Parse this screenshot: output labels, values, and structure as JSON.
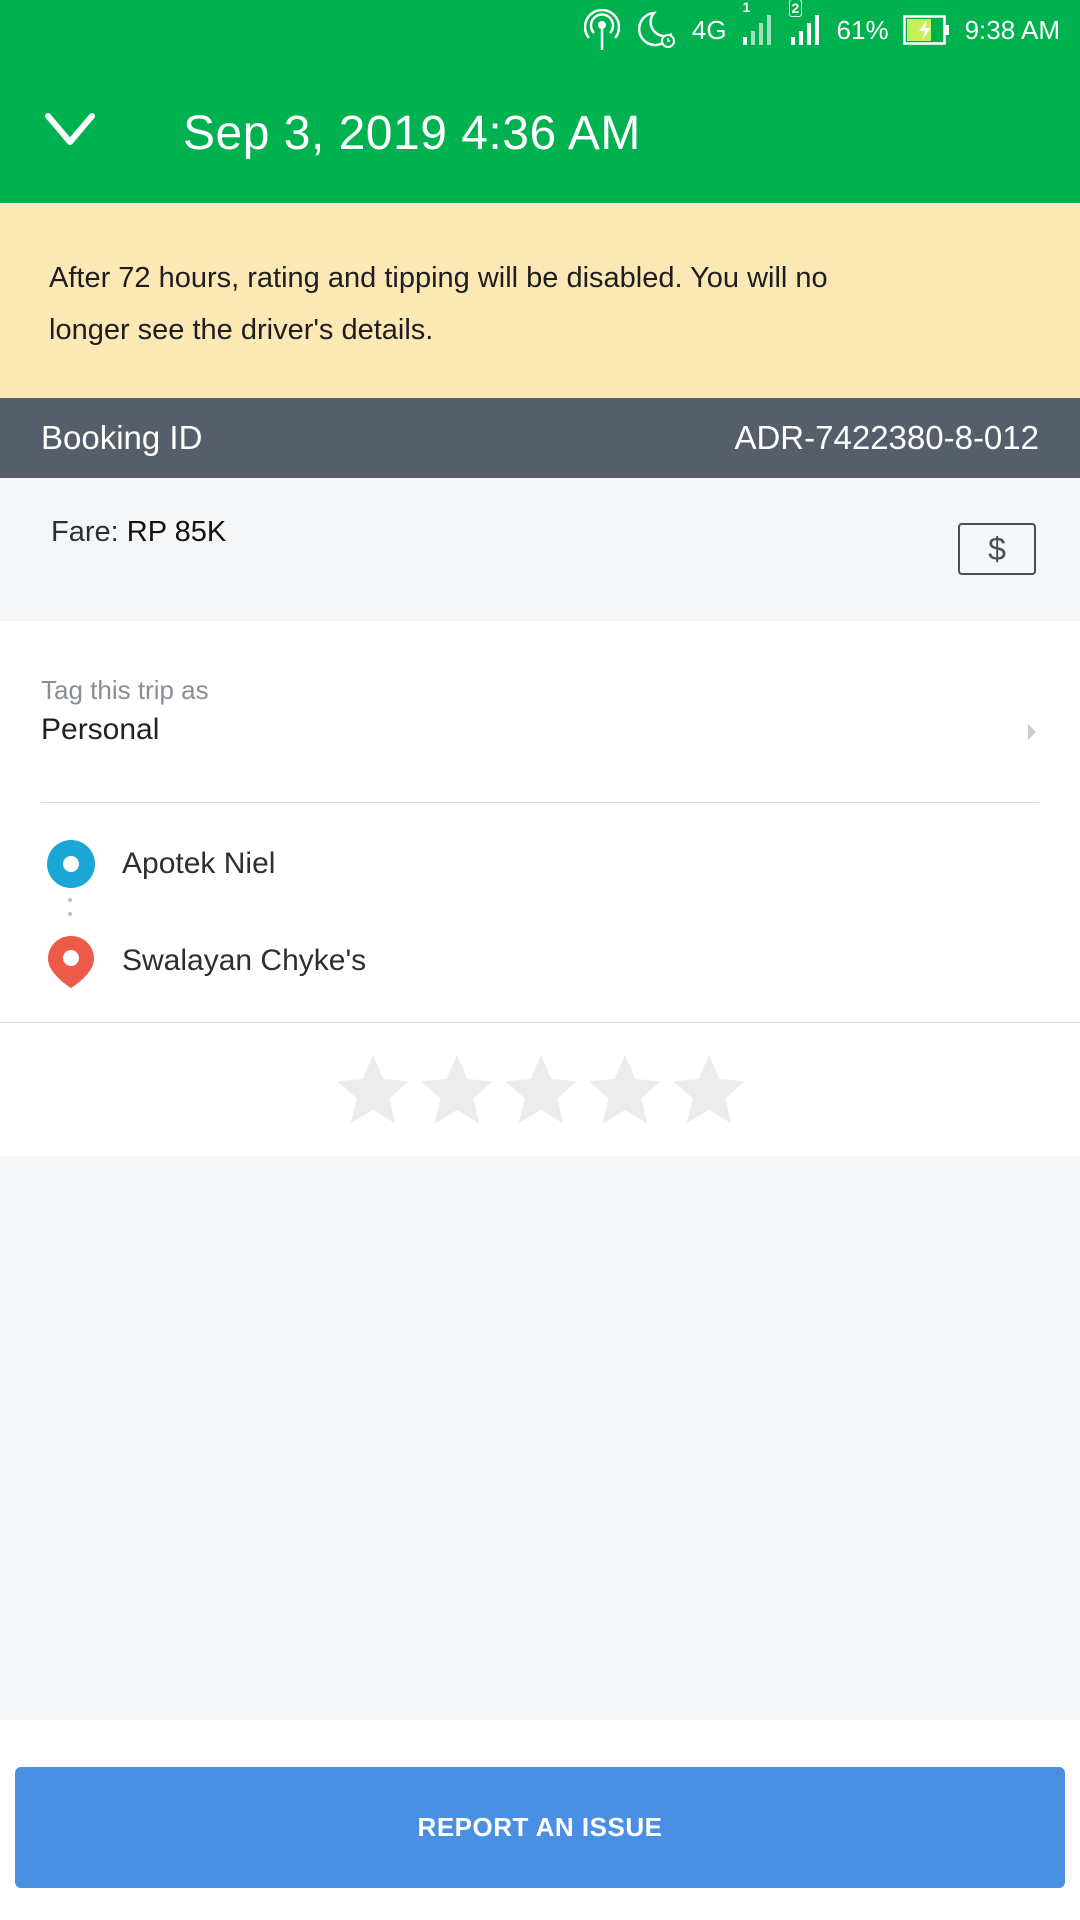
{
  "status_bar": {
    "battery": "61%",
    "time": "9:38 AM",
    "network": "4G",
    "sim1": "1",
    "sim2": "2",
    "icons": [
      "hotspot-icon",
      "dnd-alarm-icon",
      "network-4g-icon",
      "signal-sim1-icon",
      "signal-sim2-icon",
      "battery-charging-icon"
    ]
  },
  "header": {
    "title": "Sep 3, 2019 4:36 AM",
    "background": "#00b14f"
  },
  "banner": {
    "text": "After 72 hours, rating and tipping will be disabled. You will no longer see the driver's details."
  },
  "booking": {
    "label": "Booking ID",
    "value": "ADR-7422380-8-012"
  },
  "fare": {
    "label": "Fare:",
    "amount": "RP 85K",
    "icon": "$"
  },
  "tag": {
    "caption": "Tag this trip as",
    "value": "Personal"
  },
  "route": {
    "pickup": "Apotek Niel",
    "dropoff": "Swalayan Chyke's"
  },
  "rating": {
    "stars_total": 5,
    "stars_filled": 0
  },
  "actions": {
    "report_label": "REPORT AN ISSUE"
  },
  "colors": {
    "brand_green": "#00b14f",
    "banner_yellow": "#fbe8b5",
    "booking_bar": "#575e6b",
    "pickup_blue": "#1ba7d6",
    "dropoff_red": "#ee5a4a",
    "button_blue": "#4a8fe2"
  }
}
